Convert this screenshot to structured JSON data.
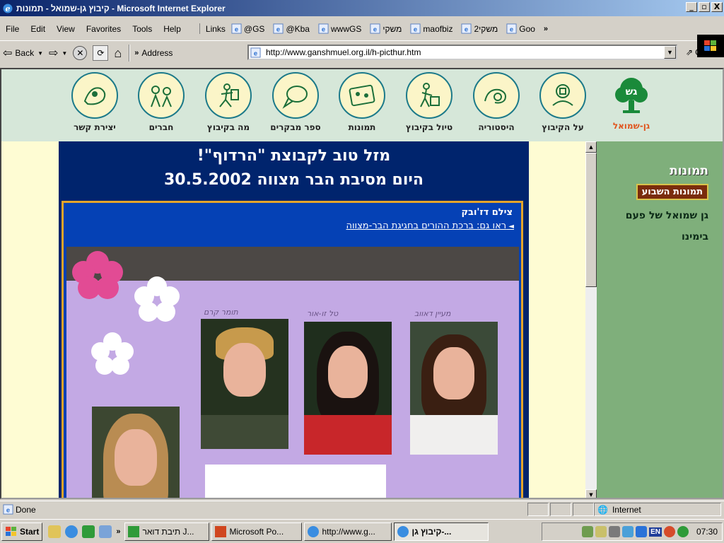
{
  "window": {
    "title": "קיבוץ גן-שמואל - תמונות - Microsoft Internet Explorer",
    "buttons": [
      "_",
      "▫",
      "X"
    ]
  },
  "menu": [
    "File",
    "Edit",
    "View",
    "Favorites",
    "Tools",
    "Help"
  ],
  "links": {
    "label": "Links",
    "items": [
      "@GS",
      "@Kba",
      "wwwGS",
      "משקי",
      "maofbiz",
      "משקי2",
      "Goo"
    ],
    "overflow": "»"
  },
  "toolbar": {
    "back": "Back",
    "overflow": "»",
    "address_label": "Address",
    "url": "http://www.ganshmuel.org.il/h-picthur.htm",
    "go": "Go"
  },
  "site": {
    "nav": [
      "יצירת קשר",
      "חברים",
      "מה בקיבוץ",
      "ספר מבקרים",
      "תמונות",
      "טיול בקיבוץ",
      "היסטוריה",
      "על הקיבוץ"
    ],
    "logo_caption": "גן-שמואל",
    "headline_1": "מזל טוב לקבוצת \"הרדוף\"!",
    "headline_2": "היום מסיבת הבר מצווה 30.5.2002",
    "photo_credit": "צילם דז'ובק",
    "see_also": "ראו גם: ברכת ההורים בחגיגת הבר-מצווה",
    "photo_names": [
      "מעיין דאווב",
      "טל זו-אור",
      "תומר קרם"
    ],
    "side": {
      "section": "תמונות",
      "active": "תמונות השבוע",
      "links": [
        "גן שמואל של פעם",
        "בימינו"
      ]
    }
  },
  "status": {
    "text": "Done",
    "zone": "Internet"
  },
  "taskbar": {
    "start": "Start",
    "overflow": "»",
    "tasks": [
      "תיבת דואר J...",
      "Microsoft Po...",
      "http://www.g...",
      "קיבוץ גן-..."
    ],
    "tray_lang": "EN",
    "clock": "07:30"
  },
  "colors": {
    "title_gradient_start": "#0a246a",
    "site_header_bg": "#d6e7d9",
    "content_bg": "#00246d",
    "side_bg": "#7faf7b",
    "accent_border": "#e5a42a"
  }
}
